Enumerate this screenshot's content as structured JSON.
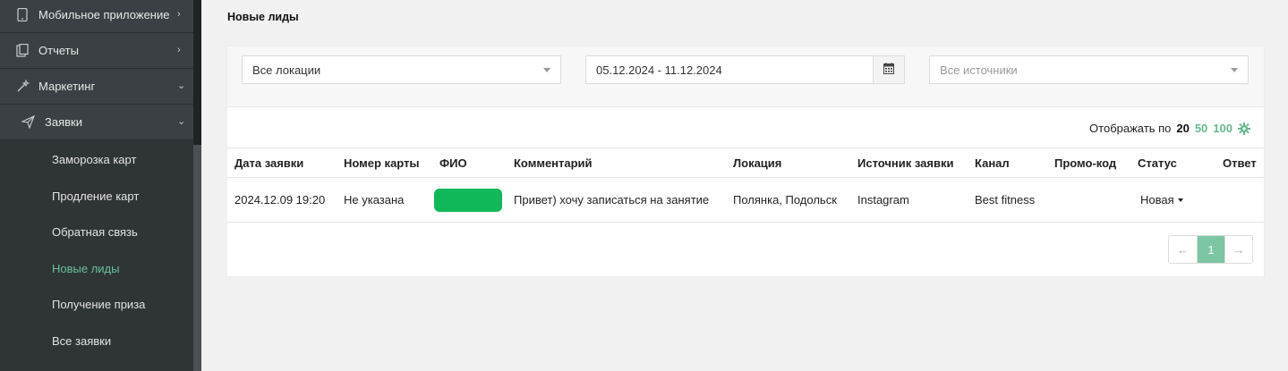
{
  "sidebar": {
    "items": [
      {
        "label": "Мобильное приложение",
        "icon": "phone-icon"
      },
      {
        "label": "Отчеты",
        "icon": "clipboard-icon"
      },
      {
        "label": "Маркетинг",
        "icon": "wand-icon"
      },
      {
        "label": "Заявки",
        "icon": "send-icon"
      }
    ],
    "subitems": [
      {
        "label": "Заморозка карт"
      },
      {
        "label": "Продление карт"
      },
      {
        "label": "Обратная связь"
      },
      {
        "label": "Новые лиды"
      },
      {
        "label": "Получение приза"
      },
      {
        "label": "Все заявки"
      }
    ]
  },
  "page": {
    "title": "Новые лиды"
  },
  "filters": {
    "location": "Все локации",
    "date_range": "05.12.2024 - 11.12.2024",
    "source_placeholder": "Все источники"
  },
  "perpage": {
    "label": "Отображать по",
    "options": [
      "20",
      "50",
      "100"
    ]
  },
  "table": {
    "headers": [
      "Дата заявки",
      "Номер карты",
      "ФИО",
      "Комментарий",
      "Локация",
      "Источник заявки",
      "Канал",
      "Промо-код",
      "Статус",
      "Ответ"
    ],
    "rows": [
      {
        "date": "2024.12.09 19:20",
        "card": "Не указана",
        "comment": "Привет) хочу записаться на занятие",
        "location": "Полянка, Подольск",
        "source": "Instagram",
        "channel": "Best fitness",
        "promo": "",
        "status": "Новая",
        "answer": ""
      }
    ]
  },
  "pagination": {
    "prev": "←",
    "current": "1",
    "next": "→"
  },
  "colors": {
    "accent": "#68b88f",
    "fio_badge": "#11b85a",
    "sidebar_bg": "#2f3437"
  }
}
